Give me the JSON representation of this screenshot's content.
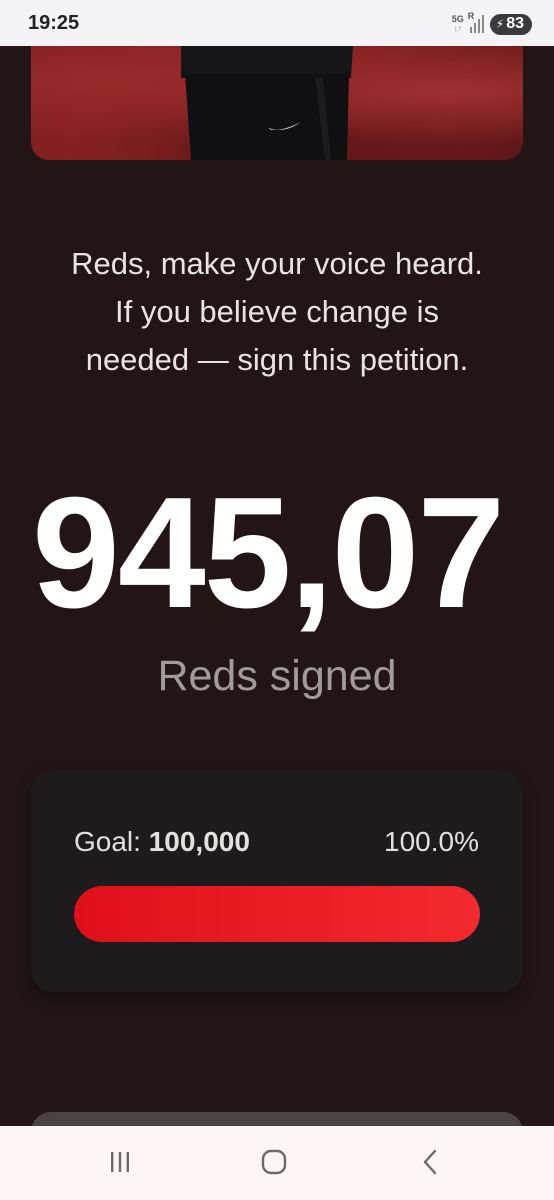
{
  "status_bar": {
    "time": "19:25",
    "network": "5G",
    "roaming": "R",
    "battery": "83"
  },
  "hero": {
    "image": "player-photo"
  },
  "message": {
    "lines": [
      "Reds, make your voice heard.",
      "If you believe change is",
      "needed — sign this petition."
    ]
  },
  "counter": {
    "count": "945,07",
    "label": "Reds signed"
  },
  "goal": {
    "label": "Goal:",
    "value": "100,000",
    "percent_text": "100.0%",
    "progress": 1.0
  },
  "colors": {
    "background": "#231516",
    "accent": "#e5141c",
    "card": "#1d1b1c"
  },
  "icons": {
    "nav_recents": "recents-icon",
    "nav_home": "home-icon",
    "nav_back": "back-icon"
  }
}
